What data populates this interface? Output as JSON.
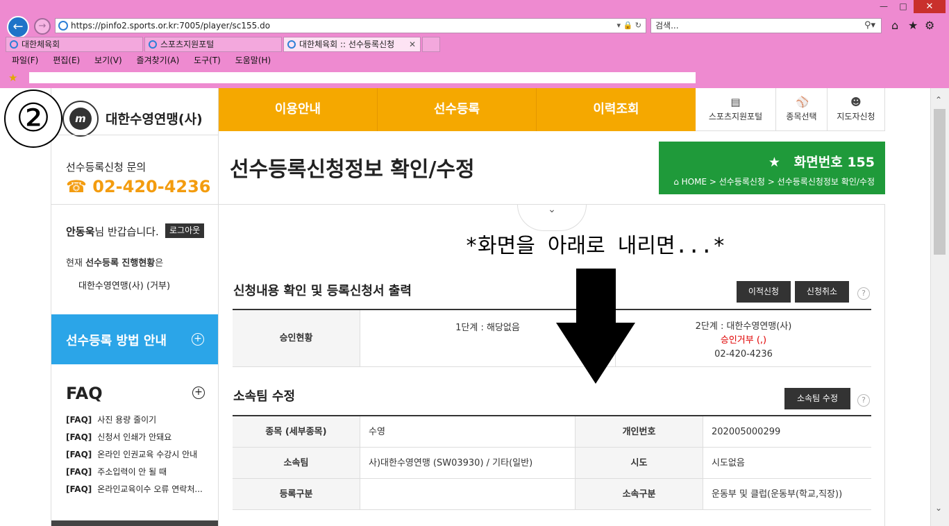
{
  "browser": {
    "url": "https://pinfo2.sports.or.kr:7005/player/sc155.do",
    "search_placeholder": "검색...",
    "tabs": [
      {
        "label": "대한체육회"
      },
      {
        "label": "스포츠지원포털"
      },
      {
        "label": "대한체육회 :: 선수등록신청"
      }
    ],
    "menu": [
      "파일(F)",
      "편집(E)",
      "보기(V)",
      "즐겨찾기(A)",
      "도구(T)",
      "도움말(H)"
    ]
  },
  "annotation": {
    "step": "②",
    "scroll_hint": "*화면을 아래로 내리면...*"
  },
  "sidebar": {
    "org_name": "대한수영연맹(사)",
    "logo_glyph": "m",
    "inquiry_label": "선수등록신청 문의",
    "inquiry_phone": "02-420-4236",
    "user_name": "안동욱",
    "greeting_suffix": "님 반갑습니다.",
    "logout_label": "로그아웃",
    "status_prefix": "현재 ",
    "status_bold": "선수등록 진행현황",
    "status_suffix": "은",
    "status_value": "대한수영연맹(사) (거부)",
    "guide_label": "선수등록 방법 안내",
    "faq_title": "FAQ",
    "faq_tag": "[FAQ]",
    "faq_items": [
      "사진 용량 줄이기",
      "신청서 인쇄가 안돼요",
      "온라인 인권교육 수강시 안내",
      "주소입력이 안 될 때",
      "온라인교육이수 오류 연락처..."
    ]
  },
  "topnav": {
    "items": [
      "이용안내",
      "선수등록",
      "이력조회"
    ],
    "utils": [
      {
        "label": "스포츠지원포털",
        "icon": "document-icon"
      },
      {
        "label": "종목선택",
        "icon": "ball-icon"
      },
      {
        "label": "지도자신청",
        "icon": "person-icon"
      }
    ]
  },
  "page": {
    "title": "선수등록신청정보 확인/수정",
    "screen_number": "화면번호 155",
    "breadcrumb": "HOME > 선수등록신청 > 선수등록신청정보 확인/수정"
  },
  "section1": {
    "title": "신청내용 확인 및 등록신청서 출력",
    "btn_transfer": "이적신청",
    "btn_cancel": "신청취소",
    "help": "?",
    "row_header": "승인현황",
    "stage1": "1단계 : 해당없음",
    "stage2": "2단계 : 대한수영연맹(사)",
    "stage2_status": "승인거부 (,)",
    "stage2_phone": "02-420-4236"
  },
  "section2": {
    "title": "소속팀 수정",
    "btn_edit": "소속팀 수정",
    "help": "?",
    "rows": [
      {
        "h1": "종목 (세부종목)",
        "v1": "수영",
        "h2": "개인번호",
        "v2": "202005000299"
      },
      {
        "h1": "소속팀",
        "v1": "사)대한수영연맹 (SW03930) / 기타(일반)",
        "h2": "시도",
        "v2": "시도없음"
      },
      {
        "h1": "등록구분",
        "v1": "",
        "h2": "소속구분",
        "v2": "운동부 및 클럽(운동부(학교,직장))"
      }
    ]
  },
  "colors": {
    "nav": "#f5a800",
    "screen_box": "#1f9a3a",
    "guide": "#2ba5e8",
    "phone": "#f39c0f",
    "reject": "#e00000"
  }
}
